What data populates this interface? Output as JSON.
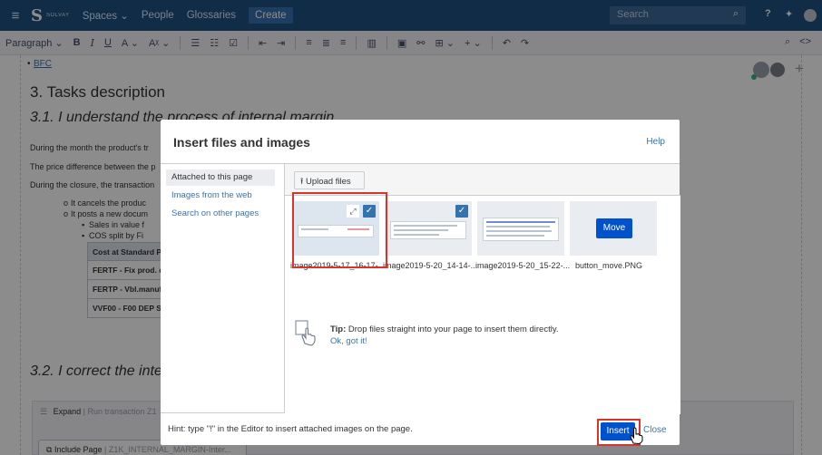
{
  "topnav": {
    "logo_text": "SOLVAY",
    "nav_items": [
      "Spaces ⌄",
      "People",
      "Glossaries"
    ],
    "create_label": "Create",
    "search_placeholder": "Search"
  },
  "toolbar": {
    "paragraph_label": "Paragraph ⌄",
    "bold": "B",
    "italic": "I",
    "underline": "U",
    "text_color": "A ⌄",
    "more_format": "Aᵡ ⌄"
  },
  "editor": {
    "bullet_link": "BFC",
    "heading_tasks": "3. Tasks description",
    "heading_3_1": "3.1. I understand the process of internal margin",
    "paragraphs": [
      "During the month the product's tr",
      "The price difference between the p",
      "During the closure, the transaction"
    ],
    "sub_items": [
      "It cancels the produc",
      "It posts a new docum"
    ],
    "sub_sub_items": [
      "Sales in value f",
      "COS split by Fi"
    ],
    "table_rows": [
      "Cost at Standard Pr",
      "FERTF - Fix prod. cc",
      "FERTP - Vbl.manuf.c",
      "VVF00 - F00 DEP St"
    ],
    "heading_3_2": "3.2. I correct the inter",
    "expand_title": "Expand",
    "expand_sub": "| Run transaction Z1",
    "include_label": "Include Page",
    "include_sub": "| Z1K_INTERNAL_MARGIN-Inter..."
  },
  "dialog": {
    "title": "Insert files and images",
    "help": "Help",
    "sidebar": [
      "Attached to this page",
      "Images from the web",
      "Search on other pages"
    ],
    "upload_label": "⭱ Upload files",
    "files": [
      {
        "name": "image2019-5-17_16-17-..."
      },
      {
        "name": "image2019-5-20_14-14-..."
      },
      {
        "name": "image2019-5-20_15-22-..."
      },
      {
        "name": "button_move.PNG",
        "preview_label": "Move"
      }
    ],
    "tip_bold": "Tip:",
    "tip_text": " Drop files straight into your page to insert them directly.",
    "tip_ok": "Ok, got it!",
    "hint": "Hint: type \"!\" in the Editor to insert attached images on the page.",
    "insert_label": "Insert",
    "close_label": "Close"
  },
  "colors": {
    "topnav": "#205081",
    "primary_button": "#0052cc",
    "highlight": "#d9342b",
    "link": "#3b73af"
  }
}
